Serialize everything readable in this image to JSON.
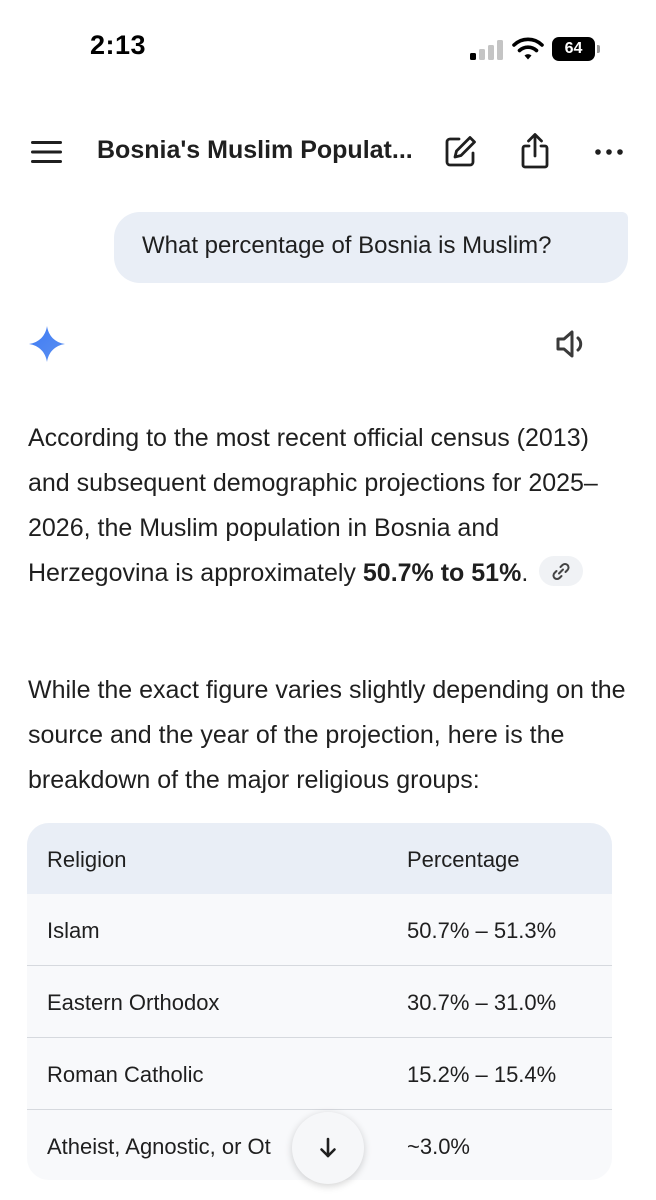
{
  "status_bar": {
    "time": "2:13",
    "battery": "64"
  },
  "header": {
    "title": "Bosnia's Muslim Populat..."
  },
  "user_message": "What percentage of Bosnia is Muslim?",
  "response": {
    "p1_before": "According to the most recent official census (2013) and subsequent demographic projections for 2025–2026, the Muslim population in Bosnia and Herzegovina is approximately ",
    "p1_bold": "50.7% to 51%",
    "p1_after": ".",
    "p2": "While the exact figure varies slightly depending on the source and the year of the projection, here is the breakdown of the major religious groups:"
  },
  "table": {
    "headers": [
      "Religion",
      "Percentage"
    ],
    "rows": [
      {
        "religion": "Islam",
        "percentage": "50.7% – 51.3%"
      },
      {
        "religion": "Eastern Orthodox",
        "percentage": "30.7% – 31.0%"
      },
      {
        "religion": "Roman Catholic",
        "percentage": "15.2% – 15.4%"
      },
      {
        "religion": "Atheist, Agnostic, or Ot",
        "percentage": "~3.0%"
      }
    ]
  },
  "icons": {
    "menu": "menu-icon",
    "edit": "edit-icon",
    "share": "share-icon",
    "more": "more-icon",
    "spark": "gemini-spark-icon",
    "speaker": "speaker-icon",
    "link": "link-icon",
    "scroll": "arrow-down-icon"
  },
  "colors": {
    "user_bubble": "#e9eef6",
    "table_header": "#e9eef6",
    "spark_blue": "#4a7df0"
  }
}
